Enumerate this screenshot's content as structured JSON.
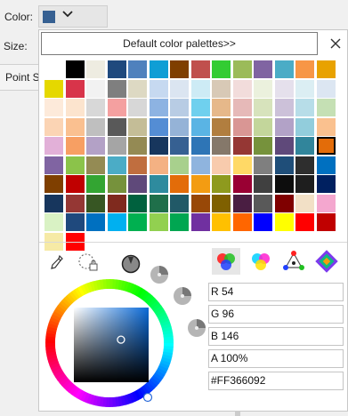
{
  "panel": {
    "color_label": "Color:",
    "size_label": "Size:",
    "tab_label": "Point S",
    "current_color": "#366092"
  },
  "popup": {
    "palette_button_label": "Default color palettes>>",
    "close_icon": "close-icon"
  },
  "palette": {
    "columns": 14,
    "selected_index": 69,
    "colors": [
      "#FFFFFF",
      "#000000",
      "#EEECE1",
      "#1F497D",
      "#4F81BD",
      "#0F9ED5",
      "#7F3F00",
      "#C0504D",
      "#33CC33",
      "#9BBB59",
      "#8064A2",
      "#4BACC6",
      "#F79646",
      "#E8A200",
      "#E5D800",
      "#D8344A",
      "#F2F2F2",
      "#7F7F7F",
      "#DDD9C3",
      "#C6D9F0",
      "#DBE5F1",
      "#CDEBF5",
      "#D8C9B6",
      "#F2DCDB",
      "#EBF1DD",
      "#E5E0EC",
      "#DBEEF3",
      "#DCE6F2",
      "#FDEADA",
      "#FCE4CE",
      "#D8D8D8",
      "#F4A0A0",
      "#D7D7D7",
      "#8DB3E2",
      "#B8CCE4",
      "#6FD0EE",
      "#E6B88A",
      "#E6B9B8",
      "#D7E3BC",
      "#CCC1D9",
      "#B7DDE8",
      "#C5E0B4",
      "#FBD4B4",
      "#FAC090",
      "#BFBFBF",
      "#595959",
      "#C4BD97",
      "#548DD4",
      "#95B3D7",
      "#5AB4E4",
      "#B17E3F",
      "#D99694",
      "#C3D69B",
      "#B2A2C7",
      "#92CDDC",
      "#FAC18F",
      "#E2B0D8",
      "#F79F63",
      "#B3A1C6",
      "#A5A5A5",
      "#948A54",
      "#17365D",
      "#366092",
      "#2E75B6",
      "#85786A",
      "#953734",
      "#76923C",
      "#5F497A",
      "#31859B",
      "#E36C09",
      "#8064A2",
      "#8BC34A",
      "#948B54",
      "#4BACC6",
      "#C06E3F",
      "#F4B183",
      "#A8D08D",
      "#8FB4DE",
      "#F8CBAD",
      "#FFD966",
      "#7F7F7F",
      "#1F4E79",
      "#2E2E2E",
      "#0070C0",
      "#7F3F00",
      "#C00000",
      "#33A532",
      "#76923C",
      "#5F497A",
      "#2E8B9E",
      "#E36C09",
      "#F39C12",
      "#8E9A1E",
      "#990033",
      "#404040",
      "#0D0D0D",
      "#1E1E1E",
      "#002060",
      "#17365D",
      "#953734",
      "#375623",
      "#7F2A1E",
      "#00613E",
      "#1F6F4A",
      "#215967",
      "#984807",
      "#7F6000",
      "#4A1E42",
      "#595959",
      "#7F0000",
      "#F2E0C6",
      "#F4A7CF",
      "#D9F2C4",
      "#1F497D",
      "#0070C0",
      "#00B0F0",
      "#00B050",
      "#92D050",
      "#00A651",
      "#7030A0",
      "#FFC000",
      "#FF6600",
      "#0000FF",
      "#FFFF00",
      "#FF0000",
      "#C00000",
      "#F6EAA6",
      "#FF0000",
      "#FFFFFF"
    ]
  },
  "picker": {
    "mode_tabs": [
      {
        "name": "rgb-mode-icon",
        "active": true
      },
      {
        "name": "cmy-mode-icon",
        "active": false
      },
      {
        "name": "hsl-triangle-mode-icon",
        "active": false
      },
      {
        "name": "palette-mode-icon",
        "active": false
      }
    ],
    "r_value": "R 54",
    "g_value": "G 96",
    "b_value": "B 146",
    "a_value": "A 100%",
    "hex_value": "#FF366092",
    "hue_deg": 213,
    "saturation": 0.63,
    "value": 0.57
  }
}
